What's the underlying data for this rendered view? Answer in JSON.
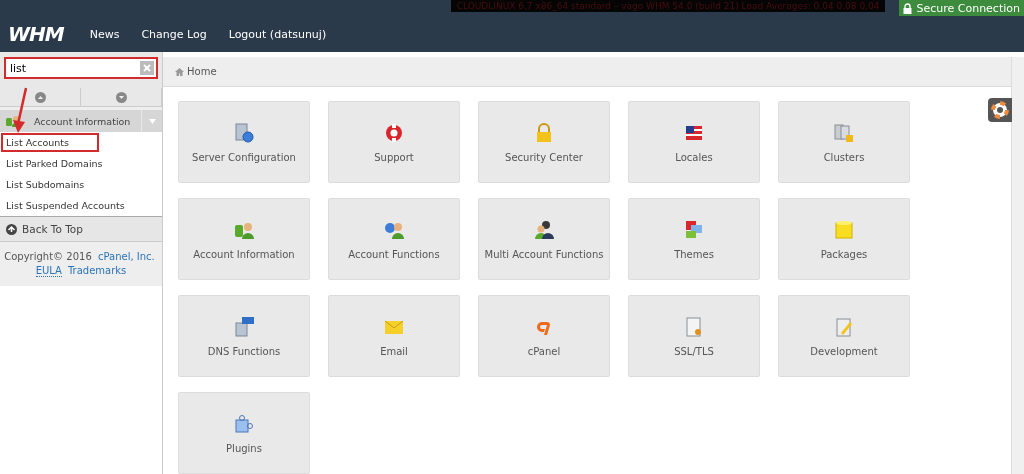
{
  "status_bar": {
    "server_info": "CLOUDLINUX 6.7 x86_64 standard – vago    WHM 54.0 (build 21)    Load Averages: 0.04 0.08 0.04",
    "secure_badge": "Secure Connection"
  },
  "nav": {
    "logo": "WHM",
    "links": [
      "News",
      "Change Log",
      "Logout (datsunuj)"
    ]
  },
  "sidebar": {
    "search": {
      "value": "list"
    },
    "section": {
      "title": "Account Information",
      "expanded": true
    },
    "items": [
      {
        "label": "List Accounts",
        "selected": true
      },
      {
        "label": "List Parked Domains",
        "selected": false
      },
      {
        "label": "List Subdomains",
        "selected": false
      },
      {
        "label": "List Suspended Accounts",
        "selected": false
      }
    ],
    "back_to_top": "Back To Top",
    "footer": {
      "copyright": "Copyright© 2016",
      "company": "cPanel, Inc.",
      "links": [
        "EULA",
        "Trademarks"
      ]
    }
  },
  "breadcrumb": "Home",
  "tiles": [
    {
      "label": "Server Configuration"
    },
    {
      "label": "Support"
    },
    {
      "label": "Security Center"
    },
    {
      "label": "Locales"
    },
    {
      "label": "Clusters"
    },
    {
      "label": "Account Information"
    },
    {
      "label": "Account Functions"
    },
    {
      "label": "Multi Account Functions"
    },
    {
      "label": "Themes"
    },
    {
      "label": "Packages"
    },
    {
      "label": "DNS Functions"
    },
    {
      "label": "Email"
    },
    {
      "label": "cPanel"
    },
    {
      "label": "SSL/TLS"
    },
    {
      "label": "Development"
    },
    {
      "label": "Plugins"
    }
  ]
}
